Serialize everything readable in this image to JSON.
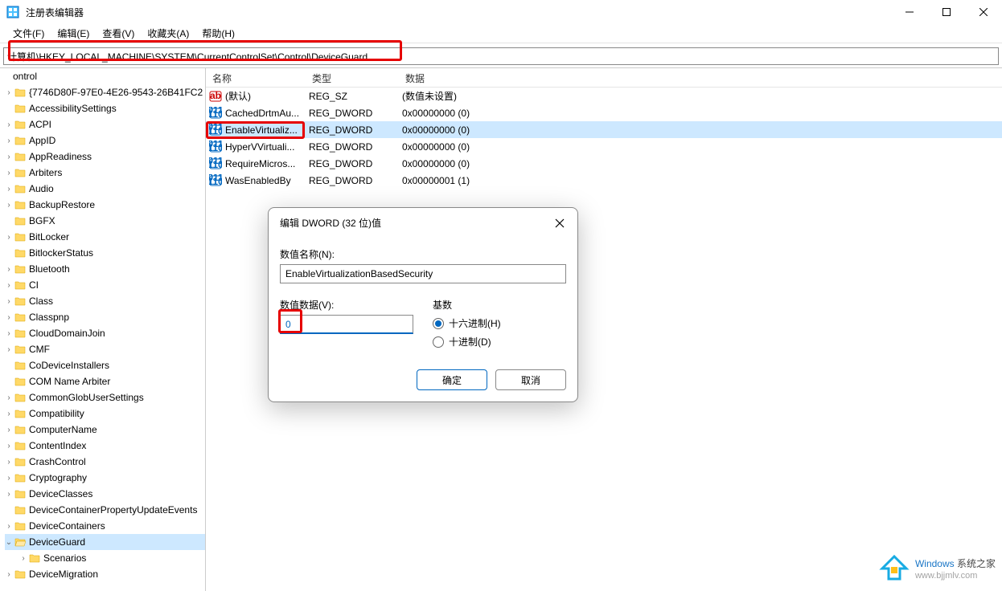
{
  "window": {
    "title": "注册表编辑器"
  },
  "menu": {
    "file": "文件(F)",
    "edit": "编辑(E)",
    "view": "查看(V)",
    "favorites": "收藏夹(A)",
    "help": "帮助(H)"
  },
  "address": {
    "value": "计算机\\HKEY_LOCAL_MACHINE\\SYSTEM\\CurrentControlSet\\Control\\DeviceGuard"
  },
  "tree": {
    "top_truncated": "ontrol",
    "items": [
      {
        "label": "{7746D80F-97E0-4E26-9543-26B41FC2",
        "level": 1,
        "expandable": true
      },
      {
        "label": "AccessibilitySettings",
        "level": 1,
        "expandable": false
      },
      {
        "label": "ACPI",
        "level": 1,
        "expandable": true
      },
      {
        "label": "AppID",
        "level": 1,
        "expandable": true
      },
      {
        "label": "AppReadiness",
        "level": 1,
        "expandable": true
      },
      {
        "label": "Arbiters",
        "level": 1,
        "expandable": true
      },
      {
        "label": "Audio",
        "level": 1,
        "expandable": true
      },
      {
        "label": "BackupRestore",
        "level": 1,
        "expandable": true
      },
      {
        "label": "BGFX",
        "level": 1,
        "expandable": false
      },
      {
        "label": "BitLocker",
        "level": 1,
        "expandable": true
      },
      {
        "label": "BitlockerStatus",
        "level": 1,
        "expandable": false
      },
      {
        "label": "Bluetooth",
        "level": 1,
        "expandable": true
      },
      {
        "label": "CI",
        "level": 1,
        "expandable": true
      },
      {
        "label": "Class",
        "level": 1,
        "expandable": true
      },
      {
        "label": "Classpnp",
        "level": 1,
        "expandable": true
      },
      {
        "label": "CloudDomainJoin",
        "level": 1,
        "expandable": true
      },
      {
        "label": "CMF",
        "level": 1,
        "expandable": true
      },
      {
        "label": "CoDeviceInstallers",
        "level": 1,
        "expandable": false
      },
      {
        "label": "COM Name Arbiter",
        "level": 1,
        "expandable": false
      },
      {
        "label": "CommonGlobUserSettings",
        "level": 1,
        "expandable": true
      },
      {
        "label": "Compatibility",
        "level": 1,
        "expandable": true
      },
      {
        "label": "ComputerName",
        "level": 1,
        "expandable": true
      },
      {
        "label": "ContentIndex",
        "level": 1,
        "expandable": true
      },
      {
        "label": "CrashControl",
        "level": 1,
        "expandable": true
      },
      {
        "label": "Cryptography",
        "level": 1,
        "expandable": true
      },
      {
        "label": "DeviceClasses",
        "level": 1,
        "expandable": true
      },
      {
        "label": "DeviceContainerPropertyUpdateEvents",
        "level": 1,
        "expandable": false
      },
      {
        "label": "DeviceContainers",
        "level": 1,
        "expandable": true
      },
      {
        "label": "DeviceGuard",
        "level": 1,
        "selected": true,
        "expandable": true,
        "expanded": true
      },
      {
        "label": "Scenarios",
        "level": 2,
        "expandable": true
      },
      {
        "label": "DeviceMigration",
        "level": 1,
        "expandable": true
      }
    ]
  },
  "list": {
    "columns": {
      "name": "名称",
      "type": "类型",
      "data": "数据"
    },
    "rows": [
      {
        "icon": "str",
        "name": "(默认)",
        "type": "REG_SZ",
        "data": "(数值未设置)"
      },
      {
        "icon": "bin",
        "name": "CachedDrtmAu...",
        "type": "REG_DWORD",
        "data": "0x00000000 (0)"
      },
      {
        "icon": "bin",
        "name": "EnableVirtualiz...",
        "type": "REG_DWORD",
        "data": "0x00000000 (0)",
        "selected": true
      },
      {
        "icon": "bin",
        "name": "HyperVVirtuali...",
        "type": "REG_DWORD",
        "data": "0x00000000 (0)"
      },
      {
        "icon": "bin",
        "name": "RequireMicros...",
        "type": "REG_DWORD",
        "data": "0x00000000 (0)"
      },
      {
        "icon": "bin",
        "name": "WasEnabledBy",
        "type": "REG_DWORD",
        "data": "0x00000001 (1)"
      }
    ]
  },
  "dialog": {
    "title": "编辑 DWORD (32 位)值",
    "name_label": "数值名称(N):",
    "name_value": "EnableVirtualizationBasedSecurity",
    "data_label": "数值数据(V):",
    "data_value": "0",
    "base_label": "基数",
    "radio_hex": "十六进制(H)",
    "radio_dec": "十进制(D)",
    "ok": "确定",
    "cancel": "取消"
  },
  "watermark": {
    "brand1": "Windows",
    "brand2": " 系统之家",
    "url": "www.bjjmlv.com"
  }
}
